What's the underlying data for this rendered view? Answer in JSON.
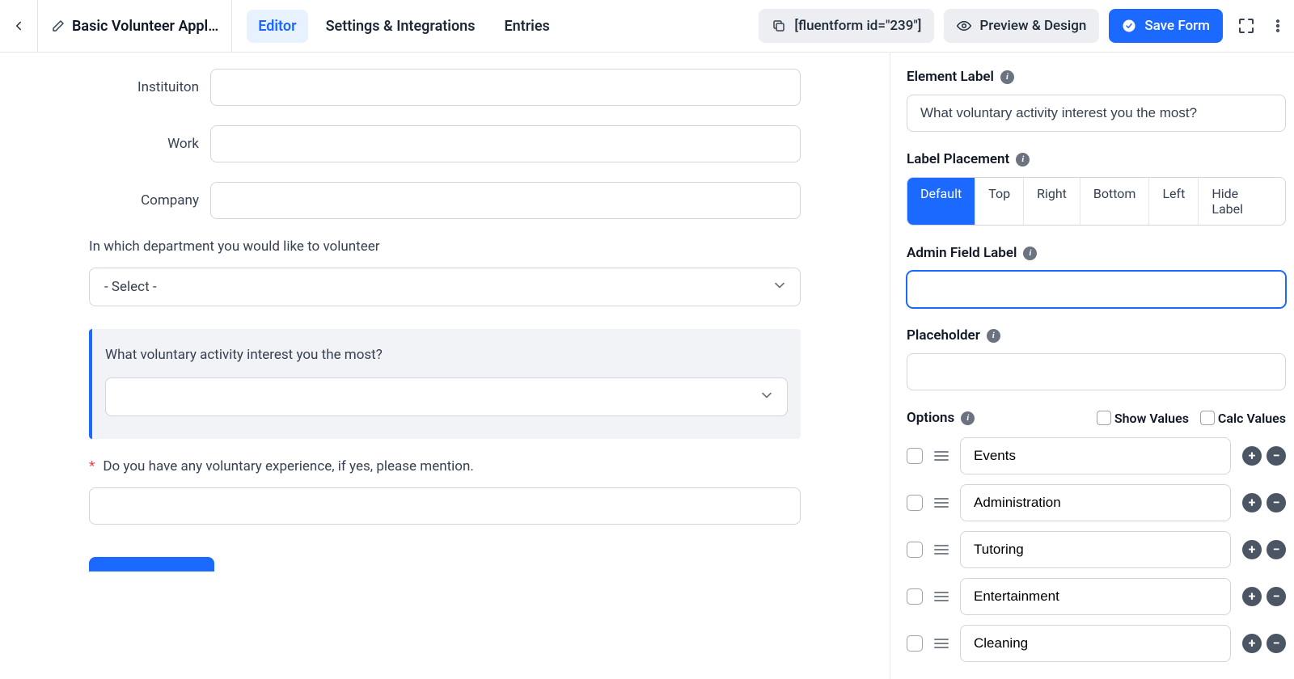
{
  "header": {
    "title": "Basic Volunteer Appl…",
    "tabs": {
      "editor": "Editor",
      "settings": "Settings & Integrations",
      "entries": "Entries"
    },
    "shortcode": "[fluentform id=\"239\"]",
    "preview": "Preview & Design",
    "save": "Save Form"
  },
  "form": {
    "fields": {
      "institution": {
        "label": "Instituiton",
        "value": ""
      },
      "work": {
        "label": "Work",
        "value": ""
      },
      "company": {
        "label": "Company",
        "value": ""
      },
      "department": {
        "label": "In which department you would like to volunteer",
        "placeholder": "- Select -"
      },
      "activity": {
        "label": "What voluntary activity interest you the most?",
        "placeholder": ""
      },
      "experience": {
        "label": "Do you have any voluntary experience, if yes, please mention.",
        "required": "*",
        "value": ""
      }
    }
  },
  "sidebar": {
    "element_label": {
      "title": "Element Label",
      "value": "What voluntary activity interest you the most?"
    },
    "label_placement": {
      "title": "Label Placement",
      "options": [
        "Default",
        "Top",
        "Right",
        "Bottom",
        "Left",
        "Hide Label"
      ],
      "active": "Default"
    },
    "admin_label": {
      "title": "Admin Field Label",
      "value": ""
    },
    "placeholder": {
      "title": "Placeholder",
      "value": ""
    },
    "options": {
      "title": "Options",
      "show_values": "Show Values",
      "calc_values": "Calc Values",
      "list": [
        "Events",
        "Administration",
        "Tutoring",
        "Entertainment",
        "Cleaning"
      ]
    }
  }
}
